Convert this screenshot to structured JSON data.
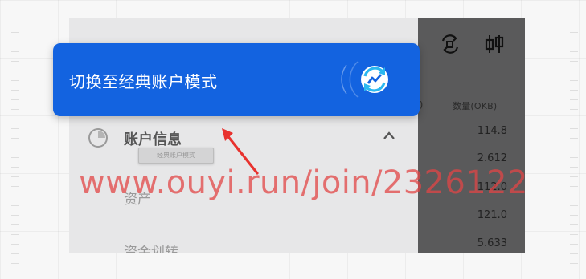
{
  "banner": {
    "text": "切换至经典账户模式",
    "icon": "switch-mode-icon",
    "background": "#1363E0"
  },
  "menu": {
    "section_title": "账户信息",
    "section_icon": "clock-icon",
    "chevron_icon": "chevron-up-icon",
    "tooltip_text": "经典账户模式",
    "items": [
      {
        "label": "资产"
      },
      {
        "label": "资金划转"
      }
    ]
  },
  "right_panel": {
    "icons": [
      "swap-icon",
      "candlestick-icon"
    ],
    "column_paren": ")",
    "column_header": "数量(OKB)",
    "values": [
      "114.8",
      "2.612",
      "112.0",
      "121.0",
      "5.633"
    ]
  },
  "watermark": "www.ouyi.run/join/2326122",
  "annotation": {
    "arrow_color": "#E8322E"
  }
}
